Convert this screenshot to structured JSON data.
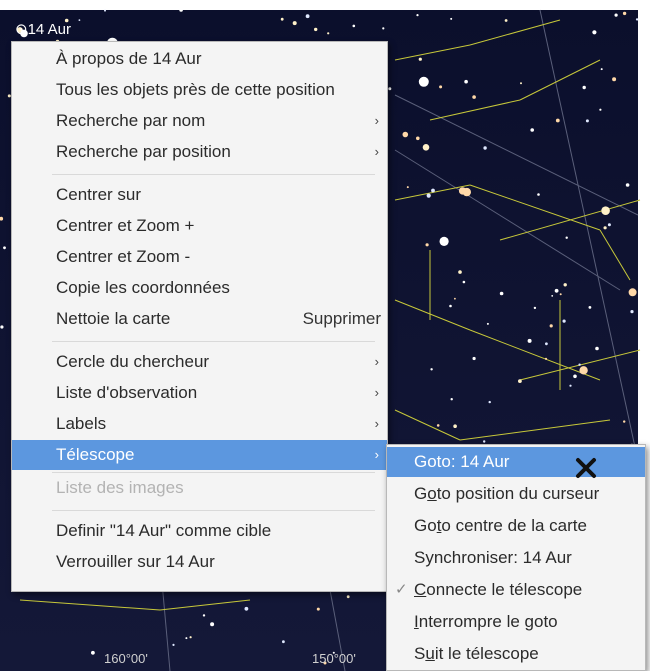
{
  "object_label": "14 Aur",
  "coords": [
    "160°00'",
    "150°00'"
  ],
  "menu": {
    "items": [
      {
        "label": "À propos de 14 Aur"
      },
      {
        "label": "Tous les objets près de cette position"
      },
      {
        "label": "Recherche par nom",
        "submenu": true
      },
      {
        "label": "Recherche par position",
        "submenu": true
      },
      {
        "label": "Centrer sur"
      },
      {
        "label": "Centrer et Zoom +"
      },
      {
        "label": "Centrer et Zoom -"
      },
      {
        "label": "Copie les coordonnées"
      },
      {
        "label": "Nettoie la carte",
        "shortcut": "Supprimer"
      },
      {
        "label": "Cercle du chercheur",
        "submenu": true
      },
      {
        "label": "Liste d'observation",
        "submenu": true
      },
      {
        "label": "Labels",
        "submenu": true
      },
      {
        "label": "Télescope",
        "submenu": true,
        "highlighted": true
      },
      {
        "label": "Liste des images",
        "disabled": true
      },
      {
        "label": "Definir \"14 Aur\" comme cible"
      },
      {
        "label": "Verrouiller sur 14 Aur"
      }
    ]
  },
  "telescope_submenu": {
    "items": [
      {
        "label": "Goto: 14 Aur",
        "highlighted": true
      },
      {
        "label": "Goto position du curseur",
        "mnemonic_index": 1
      },
      {
        "label": "Goto centre de la carte",
        "mnemonic_index": 2
      },
      {
        "label": "Synchroniser: 14 Aur"
      },
      {
        "label": "Connecte le télescope",
        "checked": true,
        "mnemonic_index": 0
      },
      {
        "label": "Interrompre le goto",
        "mnemonic_index": 0
      },
      {
        "label": "Suit le télescope",
        "mnemonic_index": 1
      }
    ]
  },
  "colors": {
    "sky_top": "#0b0f2c",
    "sky_bottom": "#141838",
    "constellation_line": "#c7c83a",
    "grid_line": "#5a5f7a",
    "highlight": "#5c97df",
    "menu_bg": "#f4f4f4"
  }
}
